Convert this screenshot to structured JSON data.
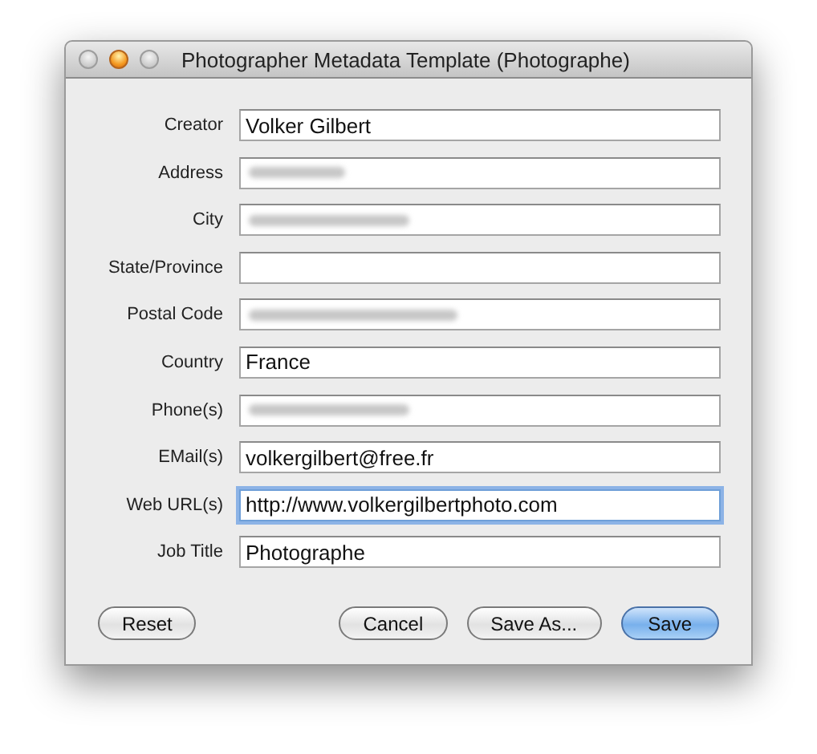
{
  "window": {
    "title": "Photographer Metadata Template (Photographe)",
    "buttons": [
      {
        "active": false
      },
      {
        "active": true
      },
      {
        "active": false
      }
    ]
  },
  "fields": [
    {
      "label": "Creator",
      "value": "Volker Gilbert",
      "redacted": false,
      "focused": false
    },
    {
      "label": "Address",
      "redacted": true,
      "focused": false
    },
    {
      "label": "City",
      "redacted": true,
      "focused": false
    },
    {
      "label": "State/Province",
      "redacted": false,
      "focused": false
    },
    {
      "label": "Postal Code",
      "redacted": true,
      "focused": false
    },
    {
      "label": "Country",
      "value": "France",
      "redacted": false,
      "focused": false
    },
    {
      "label": "Phone(s)",
      "redacted": true,
      "focused": false
    },
    {
      "label": "EMail(s)",
      "value": "volkergilbert@free.fr",
      "redacted": false,
      "focused": false
    },
    {
      "label": "Web URL(s)",
      "value": "http://www.volkergilbertphoto.com",
      "redacted": false,
      "focused": true
    },
    {
      "label": "Job Title",
      "value": "Photographe",
      "redacted": false,
      "focused": false
    }
  ],
  "left_buttons": [
    {
      "label": "Reset",
      "default": false
    }
  ],
  "right_buttons": [
    {
      "label": "Cancel",
      "default": false
    },
    {
      "label": "Save As...",
      "default": false
    },
    {
      "label": "Save",
      "default": true
    }
  ]
}
